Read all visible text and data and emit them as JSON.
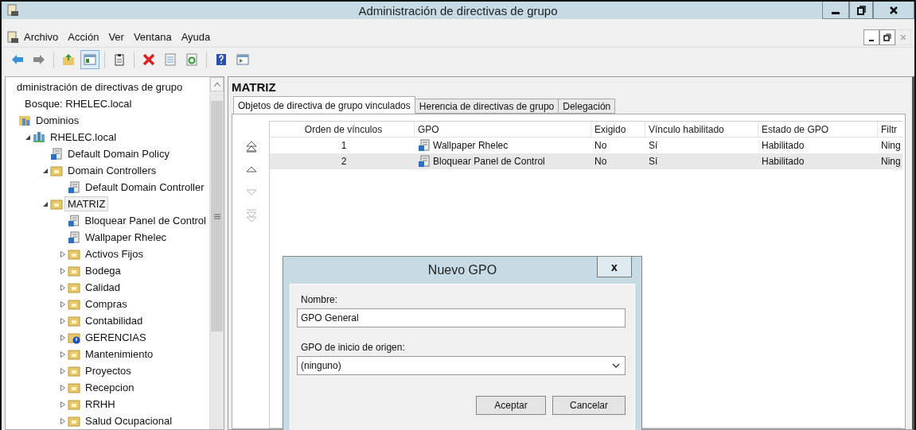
{
  "window": {
    "title": "Administración de directivas de grupo"
  },
  "menu": [
    "Archivo",
    "Acción",
    "Ver",
    "Ventana",
    "Ayuda"
  ],
  "toolbar": [
    {
      "kind": "back",
      "pressed": false
    },
    {
      "kind": "forward",
      "pressed": false
    },
    {
      "kind": "sep"
    },
    {
      "kind": "up",
      "pressed": false
    },
    {
      "kind": "tree",
      "pressed": true
    },
    {
      "kind": "sep"
    },
    {
      "kind": "clipboard",
      "pressed": false
    },
    {
      "kind": "sep"
    },
    {
      "kind": "delete",
      "pressed": false
    },
    {
      "kind": "properties",
      "pressed": false
    },
    {
      "kind": "refresh",
      "pressed": false
    },
    {
      "kind": "sep"
    },
    {
      "kind": "help",
      "pressed": false
    },
    {
      "kind": "pane",
      "pressed": false
    }
  ],
  "tree": [
    {
      "label": "dministración de directivas de grupo",
      "selected": false,
      "children": [
        {
          "label": "Bosque: RHELEC.local",
          "selected": false,
          "children": [
            {
              "label": "Dominios",
              "kind": "domains",
              "selected": false,
              "children": [
                {
                  "label": "RHELEC.local",
                  "kind": "domain",
                  "expanded": true,
                  "selected": false,
                  "children": [
                    {
                      "label": "Default Domain Policy",
                      "kind": "gpo",
                      "selected": false
                    },
                    {
                      "label": "Domain Controllers",
                      "kind": "ou",
                      "expanded": true,
                      "selected": false,
                      "children": [
                        {
                          "label": "Default Domain Controller",
                          "kind": "gpo",
                          "selected": false
                        }
                      ]
                    },
                    {
                      "label": "MATRIZ",
                      "kind": "ou",
                      "expanded": true,
                      "selected": true,
                      "children": [
                        {
                          "label": "Bloquear Panel de Control",
                          "kind": "gpo",
                          "selected": false
                        },
                        {
                          "label": "Wallpaper Rhelec",
                          "kind": "gpo",
                          "selected": false
                        },
                        {
                          "label": "Activos Fijos",
                          "kind": "ou",
                          "expanded": false,
                          "selected": false
                        },
                        {
                          "label": "Bodega",
                          "kind": "ou",
                          "expanded": false,
                          "selected": false
                        },
                        {
                          "label": "Calidad",
                          "kind": "ou",
                          "expanded": false,
                          "selected": false
                        },
                        {
                          "label": "Compras",
                          "kind": "ou",
                          "expanded": false,
                          "selected": false
                        },
                        {
                          "label": "Contabilidad",
                          "kind": "ou",
                          "expanded": false,
                          "selected": false
                        },
                        {
                          "label": "GERENCIAS",
                          "kind": "ou-alert",
                          "expanded": false,
                          "selected": false
                        },
                        {
                          "label": "Mantenimiento",
                          "kind": "ou",
                          "expanded": false,
                          "selected": false
                        },
                        {
                          "label": "Proyectos",
                          "kind": "ou",
                          "expanded": false,
                          "selected": false
                        },
                        {
                          "label": "Recepcion",
                          "kind": "ou",
                          "expanded": false,
                          "selected": false
                        },
                        {
                          "label": "RRHH",
                          "kind": "ou",
                          "expanded": false,
                          "selected": false
                        },
                        {
                          "label": "Salud Ocupacional",
                          "kind": "ou",
                          "expanded": false,
                          "selected": false
                        }
                      ]
                    }
                  ]
                }
              ]
            }
          ]
        }
      ]
    }
  ],
  "details": {
    "heading": "MATRIZ",
    "tabs": [
      {
        "label": "Objetos de directiva de grupo vinculados",
        "selected": true
      },
      {
        "label": "Herencia de directivas de grupo",
        "selected": false
      },
      {
        "label": "Delegación",
        "selected": false
      }
    ],
    "order_buttons": [
      {
        "kind": "top",
        "disabled": false
      },
      {
        "kind": "up",
        "disabled": false
      },
      {
        "kind": "down",
        "disabled": true
      },
      {
        "kind": "bottom",
        "disabled": true
      }
    ],
    "columns": [
      "Orden de vínculos",
      "GPO",
      "Exigido",
      "Vínculo habilitado",
      "Estado de GPO",
      "Filtr"
    ],
    "rows": [
      {
        "cells": [
          "1",
          "Wallpaper Rhelec",
          "No",
          "Sí",
          "Habilitado",
          "Ning"
        ],
        "selected": false
      },
      {
        "cells": [
          "2",
          "Bloquear Panel de Control",
          "No",
          "Sí",
          "Habilitado",
          "Ning"
        ],
        "selected": true
      }
    ]
  },
  "dialog": {
    "title": "Nuevo GPO",
    "close": "x",
    "name_label": "Nombre:",
    "name_value": "GPO General",
    "source_label": "GPO de inicio de origen:",
    "source_value": "(ninguno)",
    "buttons": [
      "Aceptar",
      "Cancelar"
    ]
  }
}
